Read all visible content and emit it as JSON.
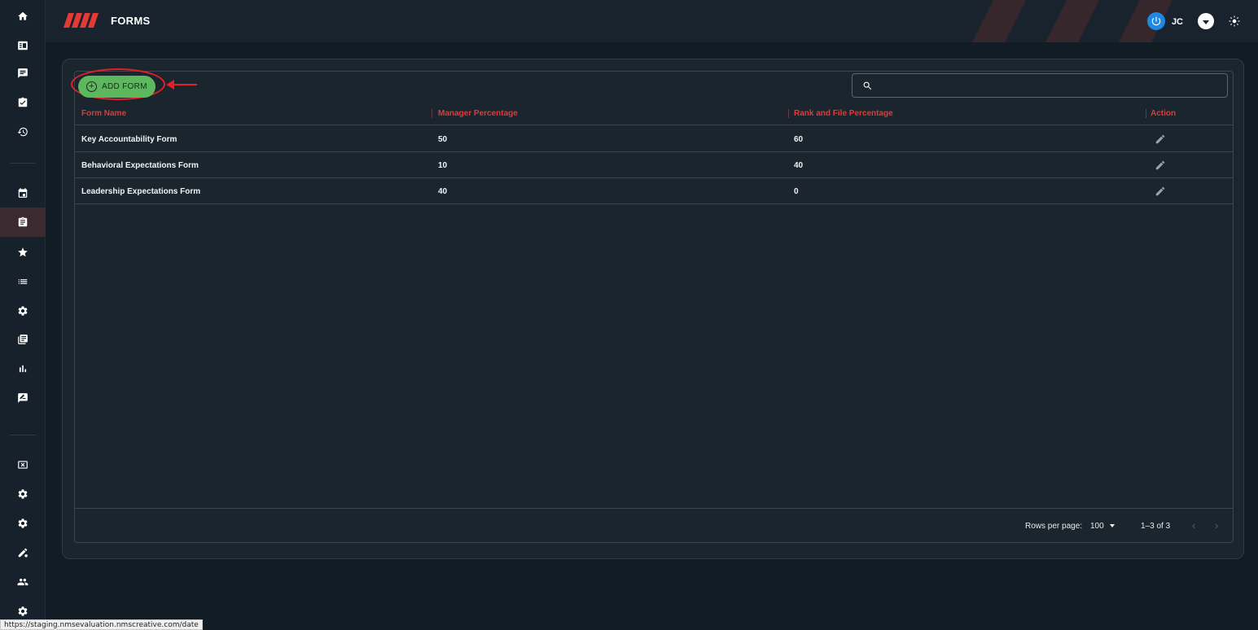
{
  "header": {
    "title": "FORMS",
    "user_initials": "JC"
  },
  "sidebar": {
    "items": [
      {
        "icon": "home-icon"
      },
      {
        "icon": "list-card-icon"
      },
      {
        "icon": "feedback-icon"
      },
      {
        "icon": "checklist-icon"
      },
      {
        "icon": "history-icon"
      },
      {
        "icon": "calendar-icon"
      },
      {
        "icon": "clipboard-icon",
        "active": true
      },
      {
        "icon": "star-icon"
      },
      {
        "icon": "list-icon"
      },
      {
        "icon": "gear-icon"
      },
      {
        "icon": "library-icon"
      },
      {
        "icon": "bar-chart-icon"
      },
      {
        "icon": "rate-review-icon"
      },
      {
        "icon": "cancel-box-icon"
      },
      {
        "icon": "gear-icon"
      },
      {
        "icon": "gear-icon"
      },
      {
        "icon": "edit-settings-icon"
      },
      {
        "icon": "group-icon"
      },
      {
        "icon": "gear-icon"
      }
    ]
  },
  "toolbar": {
    "add_label": "ADD FORM",
    "search_placeholder": ""
  },
  "table": {
    "columns": [
      "Form Name",
      "Manager Percentage",
      "Rank and File Percentage",
      "Action"
    ],
    "rows": [
      {
        "name": "Key Accountability Form",
        "manager": "50",
        "rank_file": "60"
      },
      {
        "name": "Behavioral Expectations Form",
        "manager": "10",
        "rank_file": "40"
      },
      {
        "name": "Leadership Expectations Form",
        "manager": "40",
        "rank_file": "0"
      }
    ]
  },
  "pagination": {
    "rows_per_page_label": "Rows per page:",
    "rows_per_page_value": "100",
    "range": "1–3 of 3"
  },
  "status_bar": {
    "url": "https://staging.nmsevaluation.nmscreative.com/date"
  },
  "colors": {
    "accent_red": "#e53935",
    "add_button": "#5cb85c",
    "background": "#121c24",
    "panel": "#1a252e"
  }
}
